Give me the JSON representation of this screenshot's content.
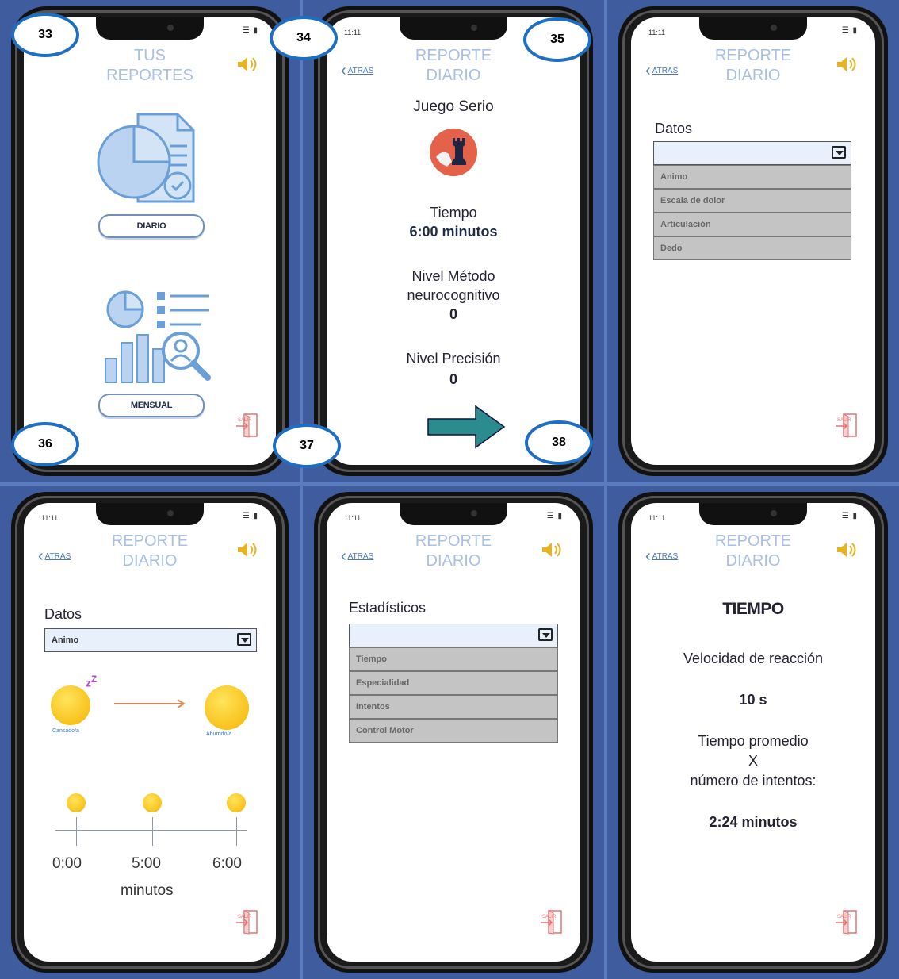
{
  "status_time": "11:11",
  "status_icons": "☰ ▮",
  "nav_back": "ATRAS",
  "markers": [
    "33",
    "34",
    "35",
    "36",
    "37",
    "38"
  ],
  "screen1": {
    "title_line1": "TUS",
    "title_line2": "REPORTES",
    "btn_daily": "DIARIO",
    "btn_monthly": "MENSUAL"
  },
  "screen2": {
    "title_line1": "REPORTE",
    "title_line2": "DIARIO",
    "game_label": "Juego Serio",
    "time_label": "Tiempo",
    "time_value": "6:00 minutos",
    "level1_label_a": "Nivel Método",
    "level1_label_b": "neurocognitivo",
    "level1_value": "0",
    "level2_label": "Nivel Precisión",
    "level2_value": "0"
  },
  "screen3": {
    "title_line1": "REPORTE",
    "title_line2": "DIARIO",
    "section": "Datos",
    "options": [
      "Animo",
      "Escala de dolor",
      "Articulación",
      "Dedo"
    ]
  },
  "screen4": {
    "title_line1": "REPORTE",
    "title_line2": "DIARIO",
    "section": "Datos",
    "selected": "Animo",
    "mood_from": "Cansado/a",
    "mood_to": "Aburrido/a",
    "ticks": [
      "0:00",
      "5:00",
      "6:00"
    ],
    "axis_label": "minutos"
  },
  "screen5": {
    "title_line1": "REPORTE",
    "title_line2": "DIARIO",
    "section": "Estadísticos",
    "options": [
      "Tiempo",
      "Especialidad",
      "Intentos",
      "Control Motor"
    ]
  },
  "screen6": {
    "title_line1": "REPORTE",
    "title_line2": "DIARIO",
    "heading": "TIEMPO",
    "reaction_label": "Velocidad de reacción",
    "reaction_value": "10 s",
    "avg_line1": "Tiempo promedio",
    "avg_line2": "X",
    "avg_line3": "número de intentos:",
    "avg_value": "2:24 minutos"
  },
  "exit_label": "SALIR",
  "colors": {
    "title": "#a9bfe3",
    "accent_blue": "#4a78c2",
    "marker_ring": "#1e6fc4",
    "arrow": "#2a8c8c",
    "speaker": "#e6b422"
  }
}
